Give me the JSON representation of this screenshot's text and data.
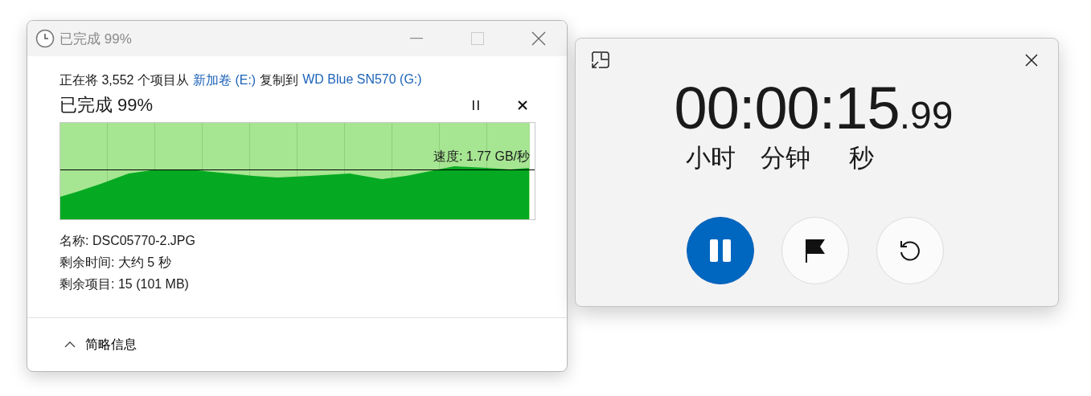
{
  "copy_dialog": {
    "title": "已完成 99%",
    "message": [
      {
        "kind": "text",
        "text": "正在将 3,552 个项目从"
      },
      {
        "kind": "link",
        "text": "新加卷 (E:)"
      },
      {
        "kind": "text",
        "text": "复制到"
      },
      {
        "kind": "link",
        "text": "WD Blue SN570 (G:)"
      }
    ],
    "progress_title": "已完成 99%",
    "progress": {
      "level": 0.99,
      "speed": "速度: 1.77 GB/秒"
    },
    "details": [
      {
        "label": "名称:",
        "value": "DSC05770-2.JPG"
      },
      {
        "label": "剩余时间:",
        "value": "大约 5 秒"
      },
      {
        "label": "剩余项目:",
        "value": "15 (101 MB)"
      }
    ],
    "footer": {
      "label": "简略信息"
    }
  },
  "stopwatch": {
    "time": "00:00:15",
    "fraction": ".99",
    "units": [
      "小时",
      "分钟",
      "秒"
    ],
    "buttons": [
      {
        "kind": "pause",
        "primary": true
      },
      {
        "kind": "lap",
        "primary": false
      },
      {
        "kind": "reset",
        "primary": false
      }
    ]
  }
}
